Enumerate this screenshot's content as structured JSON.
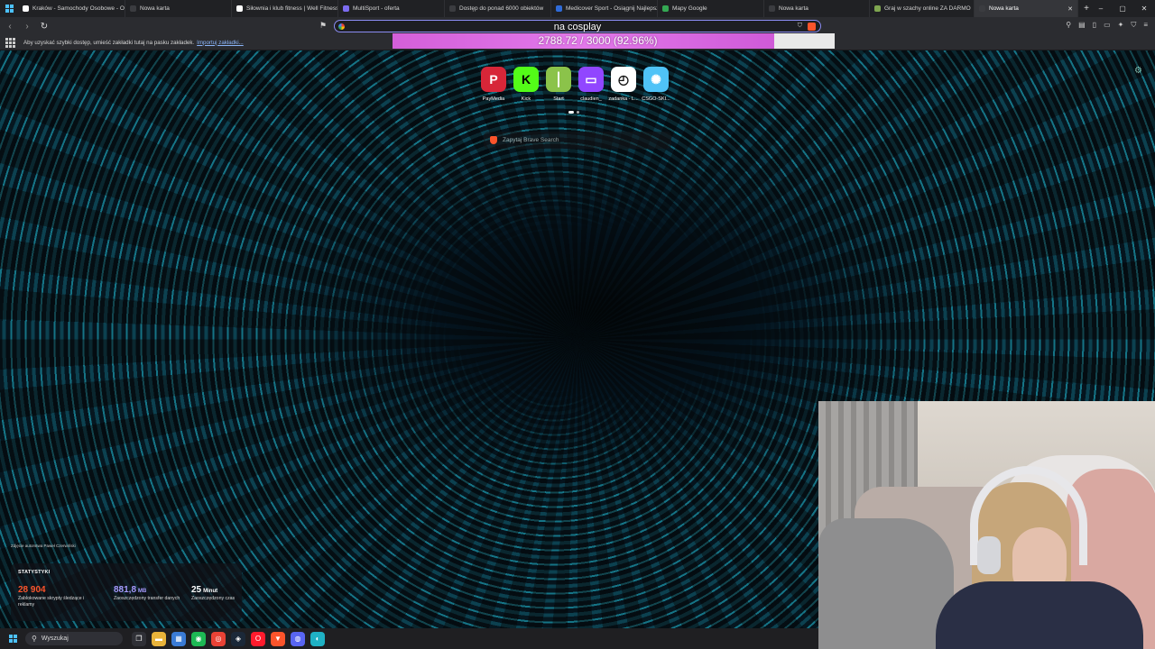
{
  "tabs": [
    {
      "title": "Kraków - Samochody Osobowe - OLX",
      "fav": "#ffffff",
      "width": 119
    },
    {
      "title": "Nowa karta",
      "fav": "#3b3c40",
      "width": 118
    },
    {
      "title": "Siłownia i klub fitness | Well Fitness",
      "fav": "#ffffff",
      "width": 118
    },
    {
      "title": "MultiSport - oferta",
      "fav": "#7c6cf0",
      "width": 118
    },
    {
      "title": "Dostęp do ponad 6000 obiektów",
      "fav": "#3b3c40",
      "width": 118
    },
    {
      "title": "Medicover Sport - Osiągnij Najlepsze",
      "fav": "#2f6bd8",
      "width": 118
    },
    {
      "title": "Mapy Google",
      "fav": "#34a853",
      "width": 118
    },
    {
      "title": "Nowa karta",
      "fav": "#3b3c40",
      "width": 117
    },
    {
      "title": "Graj w szachy online ZA DARMO",
      "fav": "#7fa650",
      "width": 116
    },
    {
      "title": "Nowa karta",
      "fav": "#3b3c40",
      "width": 115,
      "active": true
    }
  ],
  "new_tab_glyph": "+",
  "tab_close_glyph": "✕",
  "window_controls": {
    "minimize": "–",
    "maximize": "▢",
    "close": "✕"
  },
  "toolbar": {
    "back": "‹",
    "forward": "›",
    "reload": "↻",
    "bookmark": "🔖",
    "query": "na cosplay",
    "right_icons": [
      "⚲",
      "▤",
      "▯",
      "▭",
      "✦",
      "⛉",
      "≡"
    ]
  },
  "progress": {
    "text": "2788.72 / 3000 (92.96%)",
    "fraction": 0.9296,
    "fill_color": "#d85fdc"
  },
  "bookmarks_bar": {
    "message": "Aby uzyskać szybki dostęp, umieść zakładki tutaj na pasku zakładek.",
    "link": "Importuj zakładki..."
  },
  "top_sites": [
    {
      "name": "PayMedia",
      "glyph": "P",
      "bg": "#d72638",
      "fg": "#ffffff"
    },
    {
      "name": "Kick",
      "glyph": "K",
      "bg": "#53fc18",
      "fg": "#000000"
    },
    {
      "name": "Start",
      "glyph": "⎮",
      "bg": "#8bc34a",
      "fg": "#ffffff"
    },
    {
      "name": "claudien_",
      "glyph": "▭",
      "bg": "#9146ff",
      "fg": "#ffffff"
    },
    {
      "name": "zadanka - L...",
      "glyph": "◴",
      "bg": "#ffffff",
      "fg": "#111111"
    },
    {
      "name": "CSGO-SKI...",
      "glyph": "✺",
      "bg": "#4fc3f7",
      "fg": "#ffffff"
    }
  ],
  "search": {
    "placeholder": "Zapytaj Brave Search"
  },
  "photo_credit": "Zdjęcie autorstwa Paweł Czerwiński",
  "stats": {
    "title": "STATYSTYKI",
    "items": [
      {
        "value": "28 904",
        "unit": "",
        "desc": "Zablokowane skrypty śledzące i reklamy",
        "color": "#fb542b"
      },
      {
        "value": "881,8",
        "unit": "MB",
        "desc": "Zaoszczędzony transfer danych",
        "color": "#a59cff"
      },
      {
        "value": "25",
        "unit": "Minut",
        "desc": "Zaoszczędzony czas",
        "color": "#ffffff"
      }
    ]
  },
  "taskbar": {
    "search_label": "Wyszukaj",
    "apps": [
      {
        "name": "task-view",
        "glyph": "❐",
        "bg": "#2f3036"
      },
      {
        "name": "file-explorer",
        "glyph": "▬",
        "bg": "#e8b33a"
      },
      {
        "name": "store",
        "glyph": "▦",
        "bg": "#3a7bd5"
      },
      {
        "name": "spotify",
        "glyph": "◉",
        "bg": "#1db954"
      },
      {
        "name": "chrome",
        "glyph": "◎",
        "bg": "#e94235"
      },
      {
        "name": "steam",
        "glyph": "◈",
        "bg": "#1b2838"
      },
      {
        "name": "opera",
        "glyph": "O",
        "bg": "#ff1b2d"
      },
      {
        "name": "brave",
        "glyph": "▼",
        "bg": "#fb542b"
      },
      {
        "name": "discord",
        "glyph": "◍",
        "bg": "#5865f2"
      },
      {
        "name": "edge",
        "glyph": "◐",
        "bg": "#1fb1c4"
      }
    ]
  }
}
